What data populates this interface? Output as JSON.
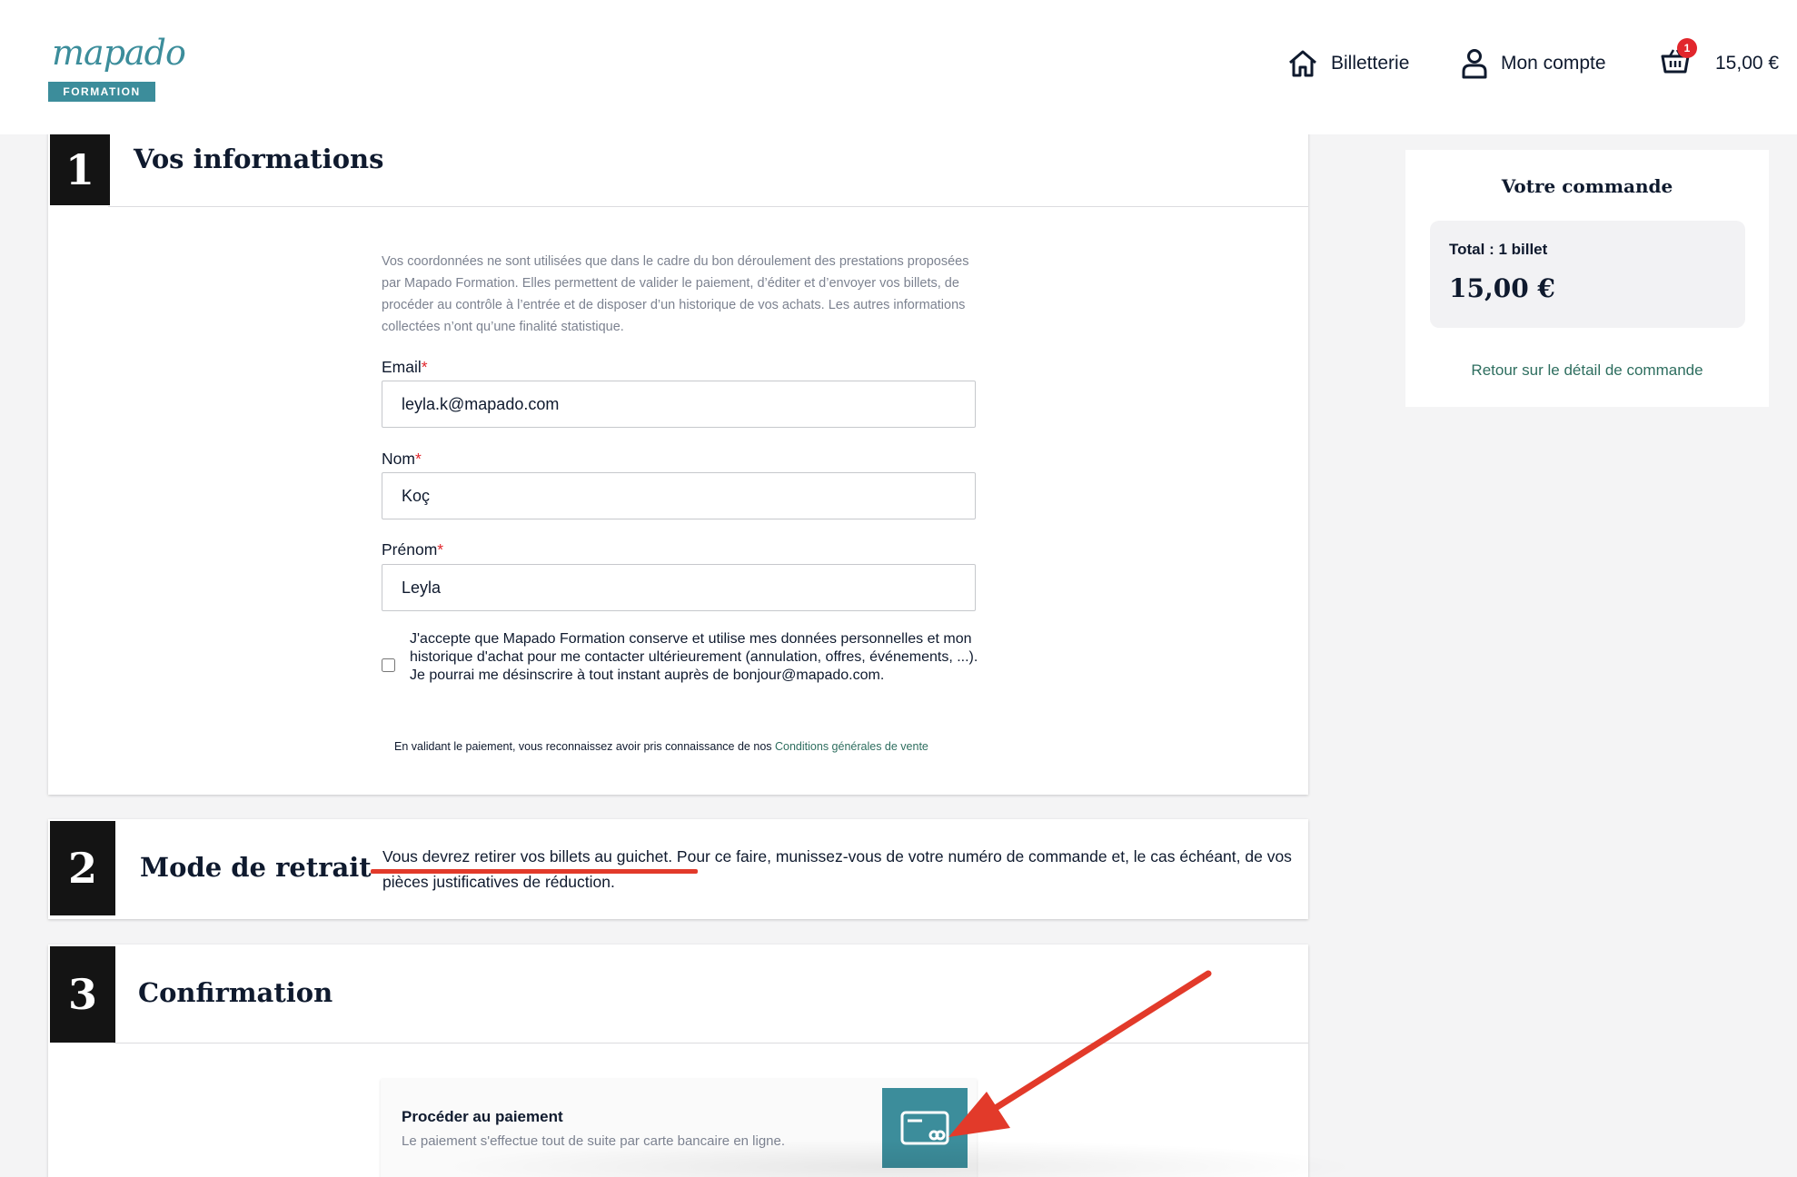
{
  "header": {
    "logo_word": "mapado",
    "logo_sub": "FORMATION",
    "nav": {
      "billetterie": "Billetterie",
      "compte": "Mon compte",
      "cart_count": "1",
      "cart_total": "15,00 €"
    }
  },
  "step1": {
    "number": "1",
    "title": "Vos informations",
    "info": "Vos coordonnées ne sont utilisées que dans le cadre du bon déroulement des prestations proposées par Mapado Formation. Elles permettent de valider le paiement, d’éditer et d’envoyer vos billets, de procéder au contrôle à l’entrée et de disposer d’un historique de vos achats. Les autres informations collectées n’ont qu’une finalité statistique.",
    "email_label": "Email",
    "email_value": "leyla.k@mapado.com",
    "nom_label": "Nom",
    "nom_value": "Koç",
    "prenom_label": "Prénom",
    "prenom_value": "Leyla",
    "required_mark": "*",
    "consent": "J'accepte que Mapado Formation conserve et utilise mes données personnelles et mon historique d'achat pour me contacter ultérieurement (annulation, offres, événements, ...). Je pourrai me désinscrire à tout instant auprès de bonjour@mapado.com.",
    "cgv_text": "En validant le paiement, vous reconnaissez avoir pris connaissance de nos ",
    "cgv_link": "Conditions générales de vente"
  },
  "step2": {
    "number": "2",
    "title": "Mode de retrait",
    "text": "Vous devrez retirer vos billets au guichet. Pour ce faire, munissez-vous de votre numéro de commande et, le cas échéant, de vos pièces justificatives de réduction."
  },
  "step3": {
    "number": "3",
    "title": "Confirmation",
    "pay_title": "Procéder au paiement",
    "pay_sub": "Le paiement s'effectue tout de suite par carte bancaire en ligne."
  },
  "sidebar": {
    "title": "Votre commande",
    "total_label": "Total : 1 billet",
    "total_value": "15,00 €",
    "back_link": "Retour sur le détail de commande"
  },
  "icons": {
    "home": "home-icon",
    "user": "user-icon",
    "cart": "basket-icon",
    "card": "credit-card-icon"
  },
  "colors": {
    "brand": "#3c8d9b",
    "link": "#2e6e5f",
    "alert": "#e1262c",
    "annotation": "#e23a2a"
  }
}
